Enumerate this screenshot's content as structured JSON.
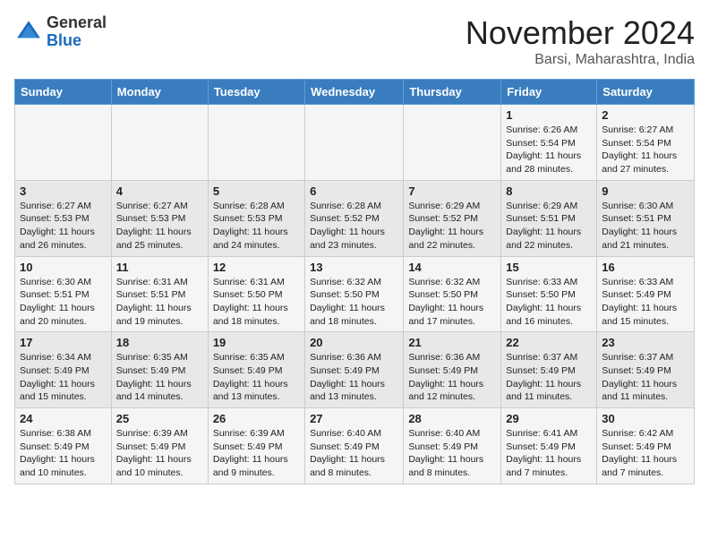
{
  "logo": {
    "general": "General",
    "blue": "Blue"
  },
  "title": "November 2024",
  "location": "Barsi, Maharashtra, India",
  "weekdays": [
    "Sunday",
    "Monday",
    "Tuesday",
    "Wednesday",
    "Thursday",
    "Friday",
    "Saturday"
  ],
  "weeks": [
    [
      {
        "day": "",
        "info": ""
      },
      {
        "day": "",
        "info": ""
      },
      {
        "day": "",
        "info": ""
      },
      {
        "day": "",
        "info": ""
      },
      {
        "day": "",
        "info": ""
      },
      {
        "day": "1",
        "info": "Sunrise: 6:26 AM\nSunset: 5:54 PM\nDaylight: 11 hours and 28 minutes."
      },
      {
        "day": "2",
        "info": "Sunrise: 6:27 AM\nSunset: 5:54 PM\nDaylight: 11 hours and 27 minutes."
      }
    ],
    [
      {
        "day": "3",
        "info": "Sunrise: 6:27 AM\nSunset: 5:53 PM\nDaylight: 11 hours and 26 minutes."
      },
      {
        "day": "4",
        "info": "Sunrise: 6:27 AM\nSunset: 5:53 PM\nDaylight: 11 hours and 25 minutes."
      },
      {
        "day": "5",
        "info": "Sunrise: 6:28 AM\nSunset: 5:53 PM\nDaylight: 11 hours and 24 minutes."
      },
      {
        "day": "6",
        "info": "Sunrise: 6:28 AM\nSunset: 5:52 PM\nDaylight: 11 hours and 23 minutes."
      },
      {
        "day": "7",
        "info": "Sunrise: 6:29 AM\nSunset: 5:52 PM\nDaylight: 11 hours and 22 minutes."
      },
      {
        "day": "8",
        "info": "Sunrise: 6:29 AM\nSunset: 5:51 PM\nDaylight: 11 hours and 22 minutes."
      },
      {
        "day": "9",
        "info": "Sunrise: 6:30 AM\nSunset: 5:51 PM\nDaylight: 11 hours and 21 minutes."
      }
    ],
    [
      {
        "day": "10",
        "info": "Sunrise: 6:30 AM\nSunset: 5:51 PM\nDaylight: 11 hours and 20 minutes."
      },
      {
        "day": "11",
        "info": "Sunrise: 6:31 AM\nSunset: 5:51 PM\nDaylight: 11 hours and 19 minutes."
      },
      {
        "day": "12",
        "info": "Sunrise: 6:31 AM\nSunset: 5:50 PM\nDaylight: 11 hours and 18 minutes."
      },
      {
        "day": "13",
        "info": "Sunrise: 6:32 AM\nSunset: 5:50 PM\nDaylight: 11 hours and 18 minutes."
      },
      {
        "day": "14",
        "info": "Sunrise: 6:32 AM\nSunset: 5:50 PM\nDaylight: 11 hours and 17 minutes."
      },
      {
        "day": "15",
        "info": "Sunrise: 6:33 AM\nSunset: 5:50 PM\nDaylight: 11 hours and 16 minutes."
      },
      {
        "day": "16",
        "info": "Sunrise: 6:33 AM\nSunset: 5:49 PM\nDaylight: 11 hours and 15 minutes."
      }
    ],
    [
      {
        "day": "17",
        "info": "Sunrise: 6:34 AM\nSunset: 5:49 PM\nDaylight: 11 hours and 15 minutes."
      },
      {
        "day": "18",
        "info": "Sunrise: 6:35 AM\nSunset: 5:49 PM\nDaylight: 11 hours and 14 minutes."
      },
      {
        "day": "19",
        "info": "Sunrise: 6:35 AM\nSunset: 5:49 PM\nDaylight: 11 hours and 13 minutes."
      },
      {
        "day": "20",
        "info": "Sunrise: 6:36 AM\nSunset: 5:49 PM\nDaylight: 11 hours and 13 minutes."
      },
      {
        "day": "21",
        "info": "Sunrise: 6:36 AM\nSunset: 5:49 PM\nDaylight: 11 hours and 12 minutes."
      },
      {
        "day": "22",
        "info": "Sunrise: 6:37 AM\nSunset: 5:49 PM\nDaylight: 11 hours and 11 minutes."
      },
      {
        "day": "23",
        "info": "Sunrise: 6:37 AM\nSunset: 5:49 PM\nDaylight: 11 hours and 11 minutes."
      }
    ],
    [
      {
        "day": "24",
        "info": "Sunrise: 6:38 AM\nSunset: 5:49 PM\nDaylight: 11 hours and 10 minutes."
      },
      {
        "day": "25",
        "info": "Sunrise: 6:39 AM\nSunset: 5:49 PM\nDaylight: 11 hours and 10 minutes."
      },
      {
        "day": "26",
        "info": "Sunrise: 6:39 AM\nSunset: 5:49 PM\nDaylight: 11 hours and 9 minutes."
      },
      {
        "day": "27",
        "info": "Sunrise: 6:40 AM\nSunset: 5:49 PM\nDaylight: 11 hours and 8 minutes."
      },
      {
        "day": "28",
        "info": "Sunrise: 6:40 AM\nSunset: 5:49 PM\nDaylight: 11 hours and 8 minutes."
      },
      {
        "day": "29",
        "info": "Sunrise: 6:41 AM\nSunset: 5:49 PM\nDaylight: 11 hours and 7 minutes."
      },
      {
        "day": "30",
        "info": "Sunrise: 6:42 AM\nSunset: 5:49 PM\nDaylight: 11 hours and 7 minutes."
      }
    ]
  ]
}
